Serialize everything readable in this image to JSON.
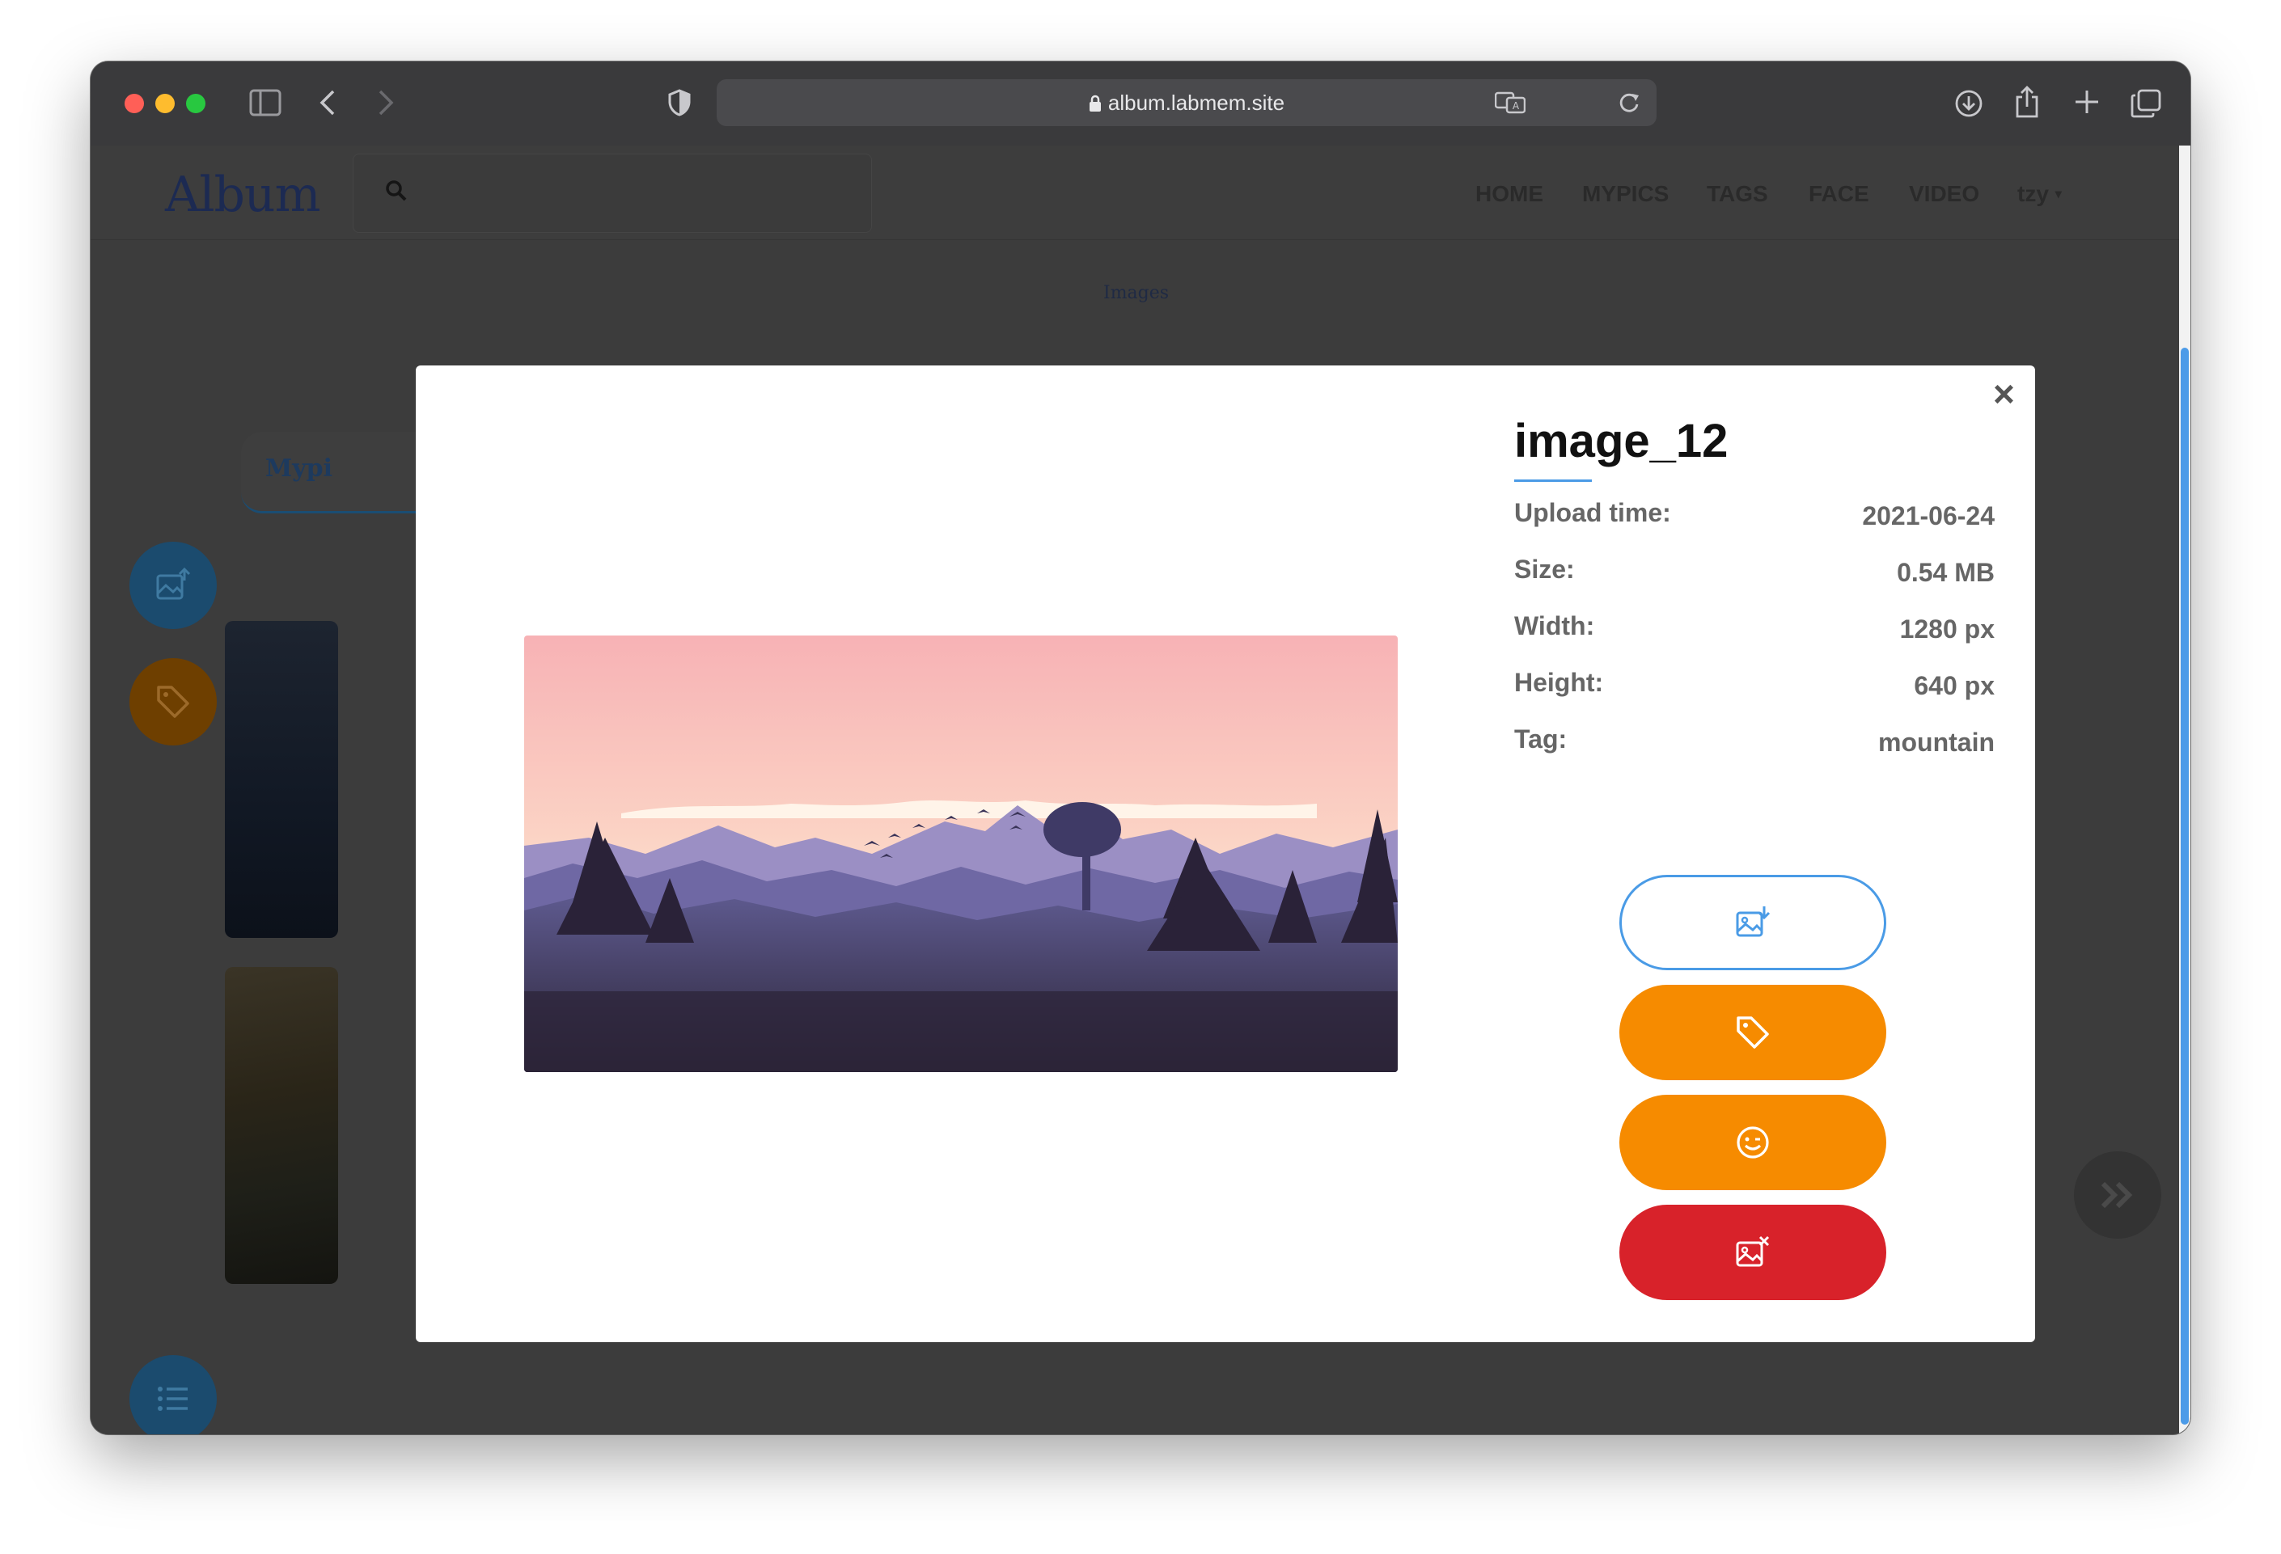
{
  "browser": {
    "url": "album.labmem.site"
  },
  "navbar": {
    "brand": "Album",
    "links": [
      "HOME",
      "MYPICS",
      "TAGS",
      "FACE",
      "VIDEO",
      "tzy"
    ]
  },
  "page": {
    "breadcrumb": "Images",
    "tab_label": "Mypi"
  },
  "modal": {
    "title": "image_12",
    "close_label": "×",
    "info": [
      {
        "label": "Upload time:",
        "value": "2021-06-24"
      },
      {
        "label": "Size:",
        "value": "0.54 MB"
      },
      {
        "label": "Width:",
        "value": "1280 px"
      },
      {
        "label": "Height:",
        "value": "640 px"
      },
      {
        "label": "Tag:",
        "value": "mountain"
      }
    ],
    "actions": [
      {
        "icon": "image-download-icon",
        "color": "#4a9be6"
      },
      {
        "icon": "tag-icon",
        "color": "#f68b00"
      },
      {
        "icon": "smile-wink-icon",
        "color": "#f68b00"
      },
      {
        "icon": "image-delete-icon",
        "color": "#d8222a"
      }
    ]
  },
  "colors": {
    "accent_blue": "#4a9be6",
    "orange": "#f68b00",
    "red": "#d8222a"
  }
}
